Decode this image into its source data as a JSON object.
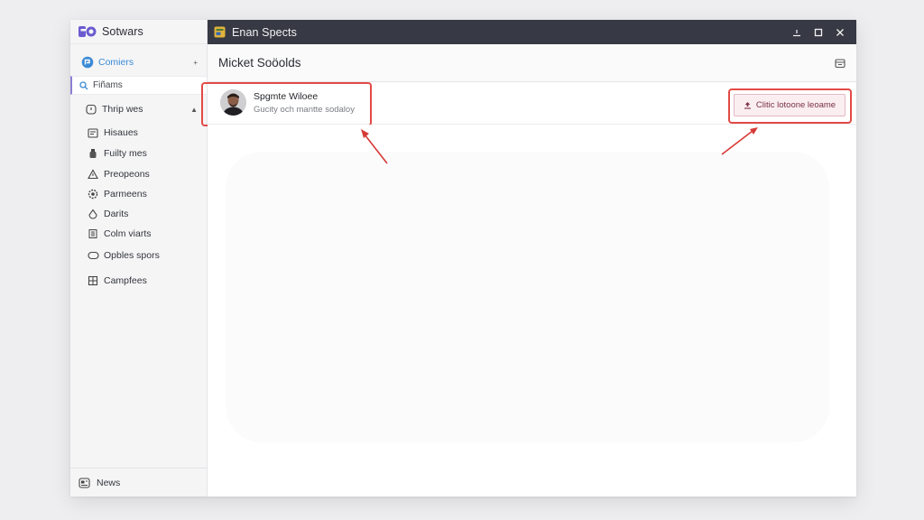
{
  "sidebar": {
    "brand_title": "Sotwars",
    "top_item": "Comiers",
    "search_label": "Fiñams",
    "section_label": "Thrip wes",
    "items": [
      {
        "label": "Hisaues",
        "icon": "id-card-icon"
      },
      {
        "label": "Fuilty mes",
        "icon": "bottle-icon"
      },
      {
        "label": "Preopeons",
        "icon": "triangle-icon"
      },
      {
        "label": "Parmeens",
        "icon": "gear-icon"
      },
      {
        "label": "Darits",
        "icon": "drop-icon"
      },
      {
        "label": "Colm viarts",
        "icon": "list-icon"
      },
      {
        "label": "Opbles spors",
        "icon": "toggle-icon"
      },
      {
        "label": "Campfees",
        "icon": "grid-icon"
      }
    ],
    "footer_label": "News"
  },
  "window": {
    "title": "Enan Spects",
    "controls": [
      "minimize-icon",
      "maximize-icon",
      "close-icon"
    ]
  },
  "header": {
    "page_title": "Micket Soöolds"
  },
  "profile": {
    "name": "Spgmte Wiloee",
    "subtitle": "Gucity och mantte sodaloy"
  },
  "action": {
    "label": "Clitic lotoone leoame"
  },
  "colors": {
    "titlebar": "#373a44",
    "highlight": "#e24a46",
    "accent": "#3a8ad6",
    "brand": "#6a5bd0"
  }
}
